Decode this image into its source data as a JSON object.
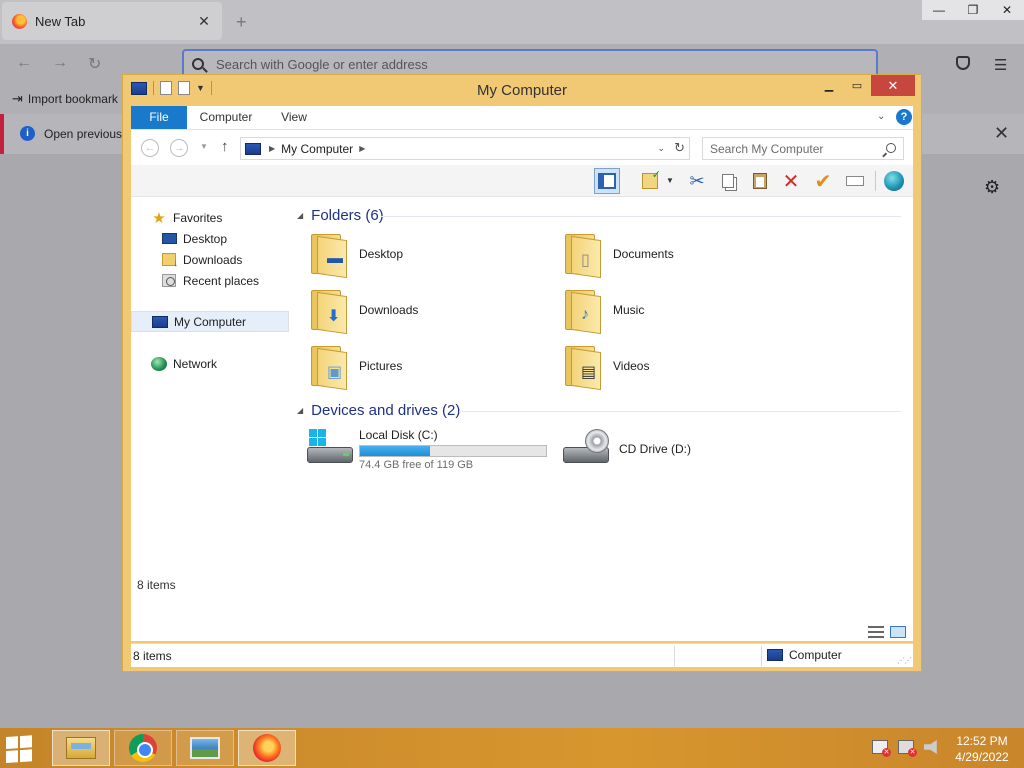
{
  "browser": {
    "tab_title": "New Tab",
    "url_placeholder": "Search with Google or enter address",
    "bookmark_label": "Import bookmark",
    "infobar_text": "Open previous"
  },
  "explorer": {
    "title": "My Computer",
    "ribbon_tabs": [
      {
        "label": "File"
      },
      {
        "label": "Computer"
      },
      {
        "label": "View"
      }
    ],
    "address_crumb": "My Computer",
    "search_placeholder": "Search My Computer",
    "nav": {
      "favorites": "Favorites",
      "desktop": "Desktop",
      "downloads": "Downloads",
      "recent": "Recent places",
      "my_computer": "My Computer",
      "network": "Network"
    },
    "folders_header": "Folders (6)",
    "folders": [
      {
        "label": "Desktop"
      },
      {
        "label": "Documents"
      },
      {
        "label": "Downloads"
      },
      {
        "label": "Music"
      },
      {
        "label": "Pictures"
      },
      {
        "label": "Videos"
      }
    ],
    "devices_header": "Devices and drives (2)",
    "drives": {
      "local": {
        "name": "Local Disk (C:)",
        "free_text": "74.4 GB free of 119 GB",
        "used_fraction": 0.375
      },
      "cd": {
        "name": "CD Drive (D:)"
      }
    },
    "items_count_inner": "8 items",
    "status_left": "8 items",
    "status_right": "Computer"
  },
  "taskbar": {
    "clock_time": "12:52 PM",
    "clock_date": "4/29/2022"
  },
  "colors": {
    "window_frame": "#f1c975",
    "accent_blue": "#1979ca",
    "close_red": "#c7463e",
    "taskbar": "#d8962e",
    "group_header": "#1e3287"
  }
}
